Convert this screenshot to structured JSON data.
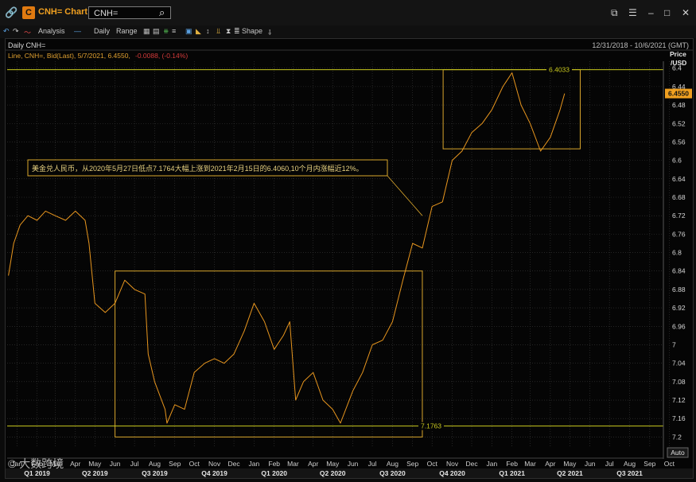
{
  "window": {
    "title": "CNH= Chart",
    "search_value": "CNH=",
    "toolbar": {
      "analysis": "Analysis",
      "interval": "Daily",
      "range": "Range",
      "shape": "Shape"
    }
  },
  "chart_header": {
    "label": "Daily CNH=",
    "date_range": "12/31/2018 - 10/6/2021 (GMT)",
    "legend_main": "Line, CNH=, Bid(Last), 5/7/2021, 6.4550,",
    "legend_change": "-0.0088, (-0.14%)",
    "price_axis_title": "Price",
    "price_axis_unit": "/USD",
    "auto_button": "Auto",
    "watermark": "© 大数跨境"
  },
  "colors": {
    "line": "#e8961e",
    "box": "#d9a62c",
    "ref_line": "#c8c81e",
    "last_price_bg": "#f0a020",
    "grid": "#3a3a3a",
    "change_red": "#d43a3a"
  },
  "chart_data": {
    "type": "line",
    "series": [
      {
        "name": "CNH=",
        "x": [
          "2019-01-02",
          "2019-01-10",
          "2019-01-20",
          "2019-02-01",
          "2019-02-15",
          "2019-02-28",
          "2019-03-15",
          "2019-03-31",
          "2019-04-15",
          "2019-04-30",
          "2019-05-06",
          "2019-05-15",
          "2019-05-31",
          "2019-06-15",
          "2019-06-30",
          "2019-07-15",
          "2019-07-31",
          "2019-08-05",
          "2019-08-15",
          "2019-08-31",
          "2019-09-03",
          "2019-09-15",
          "2019-09-30",
          "2019-10-15",
          "2019-10-31",
          "2019-11-15",
          "2019-11-30",
          "2019-12-15",
          "2019-12-31",
          "2020-01-15",
          "2020-01-31",
          "2020-02-15",
          "2020-02-29",
          "2020-03-10",
          "2020-03-19",
          "2020-03-31",
          "2020-04-15",
          "2020-04-30",
          "2020-05-15",
          "2020-05-27",
          "2020-06-15",
          "2020-06-30",
          "2020-07-15",
          "2020-07-31",
          "2020-08-15",
          "2020-08-31",
          "2020-09-15",
          "2020-09-30",
          "2020-10-15",
          "2020-10-31",
          "2020-11-15",
          "2020-11-30",
          "2020-12-15",
          "2020-12-31",
          "2021-01-15",
          "2021-02-01",
          "2021-02-15",
          "2021-03-01",
          "2021-03-15",
          "2021-03-31",
          "2021-04-15",
          "2021-04-30",
          "2021-05-07"
        ],
        "y": [
          6.85,
          6.78,
          6.74,
          6.72,
          6.73,
          6.71,
          6.72,
          6.73,
          6.71,
          6.73,
          6.78,
          6.91,
          6.93,
          6.91,
          6.86,
          6.88,
          6.89,
          7.02,
          7.08,
          7.14,
          7.17,
          7.13,
          7.14,
          7.06,
          7.04,
          7.03,
          7.04,
          7.02,
          6.97,
          6.91,
          6.95,
          7.01,
          6.98,
          6.95,
          7.12,
          7.08,
          7.06,
          7.12,
          7.14,
          7.17,
          7.1,
          7.06,
          7.0,
          6.99,
          6.95,
          6.86,
          6.78,
          6.79,
          6.7,
          6.69,
          6.6,
          6.58,
          6.54,
          6.52,
          6.49,
          6.44,
          6.41,
          6.48,
          6.52,
          6.58,
          6.55,
          6.49,
          6.455
        ]
      }
    ],
    "y_axis": {
      "title": "Price /USD",
      "inverted": true,
      "range": [
        6.385,
        7.22
      ],
      "ticks": [
        6.4,
        6.44,
        6.48,
        6.52,
        6.56,
        6.6,
        6.64,
        6.68,
        6.72,
        6.76,
        6.8,
        6.84,
        6.88,
        6.92,
        6.96,
        7,
        7.04,
        7.08,
        7.12,
        7.16,
        7.2
      ],
      "tick_labels": [
        "6.4",
        "6.44",
        "6.48",
        "6.52",
        "6.56",
        "6.6",
        "6.64",
        "6.68",
        "6.72",
        "6.76",
        "6.8",
        "6.84",
        "6.88",
        "6.92",
        "6.96",
        "7",
        "7.04",
        "7.08",
        "7.12",
        "7.16",
        "7.2"
      ],
      "last_price": 6.455,
      "last_price_label": "6.4550"
    },
    "x_axis": {
      "range": [
        "2018-12-31",
        "2021-10-06"
      ],
      "month_ticks": [
        {
          "date": "2019-01-15",
          "label": "Jan"
        },
        {
          "date": "2019-02-15",
          "label": "Feb"
        },
        {
          "date": "2019-03-15",
          "label": "Mar"
        },
        {
          "date": "2019-04-15",
          "label": "Apr"
        },
        {
          "date": "2019-05-15",
          "label": "May"
        },
        {
          "date": "2019-06-15",
          "label": "Jun"
        },
        {
          "date": "2019-07-15",
          "label": "Jul"
        },
        {
          "date": "2019-08-15",
          "label": "Aug"
        },
        {
          "date": "2019-09-15",
          "label": "Sep"
        },
        {
          "date": "2019-10-15",
          "label": "Oct"
        },
        {
          "date": "2019-11-15",
          "label": "Nov"
        },
        {
          "date": "2019-12-15",
          "label": "Dec"
        },
        {
          "date": "2020-01-15",
          "label": "Jan"
        },
        {
          "date": "2020-02-15",
          "label": "Feb"
        },
        {
          "date": "2020-03-15",
          "label": "Mar"
        },
        {
          "date": "2020-04-15",
          "label": "Apr"
        },
        {
          "date": "2020-05-15",
          "label": "May"
        },
        {
          "date": "2020-06-15",
          "label": "Jun"
        },
        {
          "date": "2020-07-15",
          "label": "Jul"
        },
        {
          "date": "2020-08-15",
          "label": "Aug"
        },
        {
          "date": "2020-09-15",
          "label": "Sep"
        },
        {
          "date": "2020-10-15",
          "label": "Oct"
        },
        {
          "date": "2020-11-15",
          "label": "Nov"
        },
        {
          "date": "2020-12-15",
          "label": "Dec"
        },
        {
          "date": "2021-01-15",
          "label": "Jan"
        },
        {
          "date": "2021-02-15",
          "label": "Feb"
        },
        {
          "date": "2021-03-15",
          "label": "Mar"
        },
        {
          "date": "2021-04-15",
          "label": "Apr"
        },
        {
          "date": "2021-05-15",
          "label": "May"
        },
        {
          "date": "2021-06-15",
          "label": "Jun"
        },
        {
          "date": "2021-07-15",
          "label": "Jul"
        },
        {
          "date": "2021-08-15",
          "label": "Aug"
        },
        {
          "date": "2021-09-15",
          "label": "Sep"
        },
        {
          "date": "2021-10-15",
          "label": "Oct"
        }
      ],
      "quarter_ticks": [
        {
          "date": "2019-02-15",
          "label": "Q1 2019"
        },
        {
          "date": "2019-05-15",
          "label": "Q2 2019"
        },
        {
          "date": "2019-08-15",
          "label": "Q3 2019"
        },
        {
          "date": "2019-11-15",
          "label": "Q4 2019"
        },
        {
          "date": "2020-02-15",
          "label": "Q1 2020"
        },
        {
          "date": "2020-05-15",
          "label": "Q2 2020"
        },
        {
          "date": "2020-08-15",
          "label": "Q3 2020"
        },
        {
          "date": "2020-11-15",
          "label": "Q4 2020"
        },
        {
          "date": "2021-02-15",
          "label": "Q1 2021"
        },
        {
          "date": "2021-05-15",
          "label": "Q2 2021"
        },
        {
          "date": "2021-08-15",
          "label": "Q3 2021"
        }
      ]
    },
    "reference_lines": [
      {
        "value": 6.4033,
        "label": "6.4033"
      },
      {
        "value": 7.1763,
        "label": "7.1763"
      }
    ],
    "boxes": [
      {
        "x_start": "2019-06-15",
        "x_end": "2020-09-30",
        "y_top": 6.84,
        "y_bottom": 7.2
      },
      {
        "x_start": "2020-11-01",
        "x_end": "2021-05-31",
        "y_top": 6.4033,
        "y_bottom": 6.575
      }
    ],
    "annotation": {
      "text": "美金兑人民币，从2020年5月27日低点7.1764大幅上涨到2021年2月15日的6.4060,10个月内涨幅近12%。",
      "pointer_to": {
        "date": "2020-09-30",
        "value": 6.72
      }
    },
    "grid": true
  }
}
